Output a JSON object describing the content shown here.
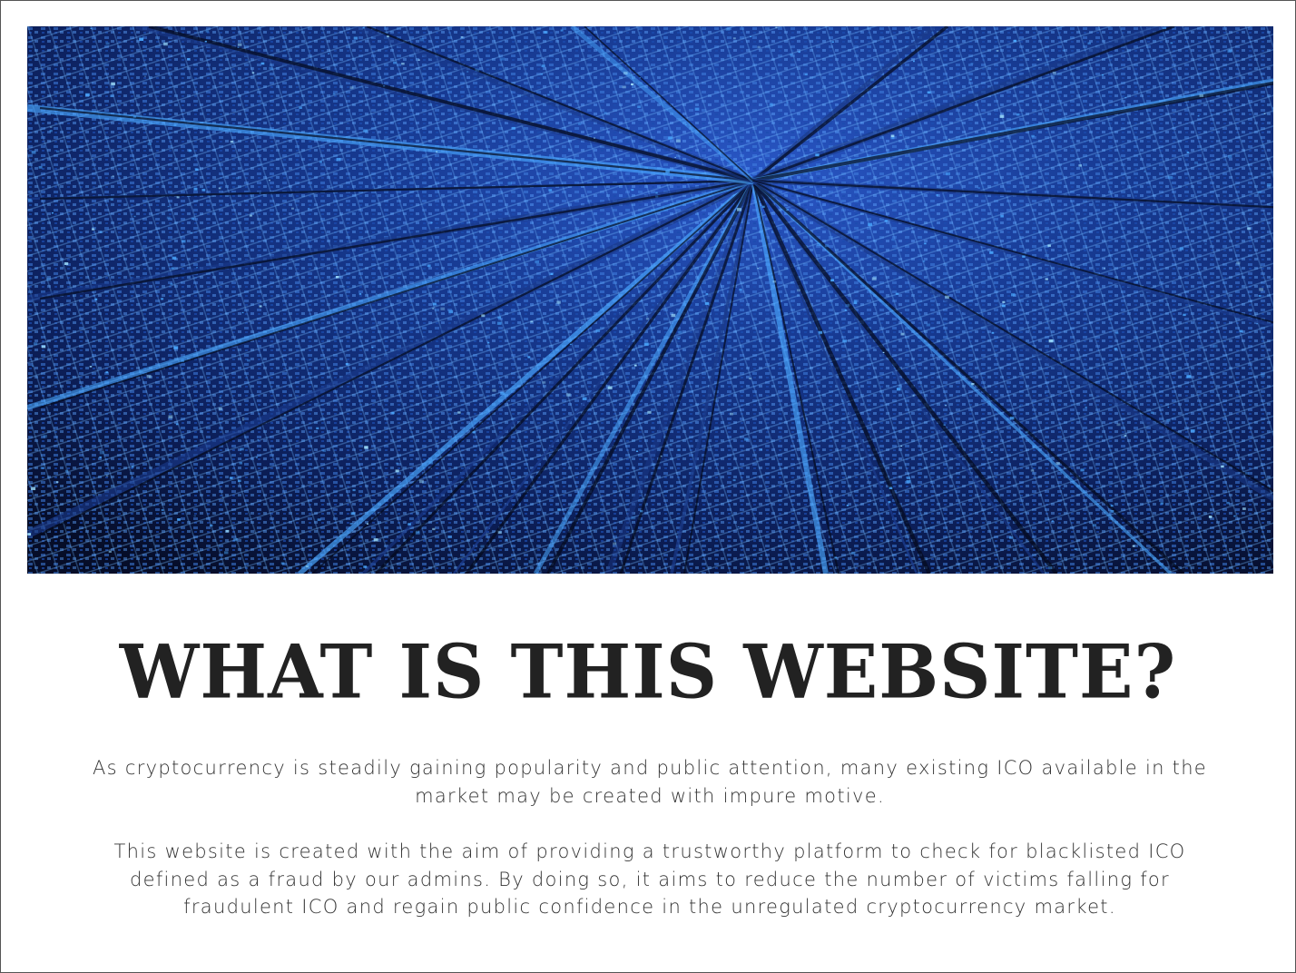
{
  "hero": {
    "image": "digital-circuit-tunnel-image",
    "colors": {
      "base": "#0a1430",
      "mid": "#1a3a8a",
      "glow": "#4aa8ff",
      "highlight": "#9fe0ff"
    }
  },
  "section": {
    "heading": "WHAT IS THIS WEBSITE?",
    "paragraph_1": "As cryptocurrency is steadily gaining popularity and public attention, many existing ICO available in the market may be created with impure motive.",
    "paragraph_2": "This website is created with the aim of providing a trustworthy platform to check for blacklisted ICO defined as a fraud by our admins. By doing so, it aims to reduce the number of victims falling for fraudulent ICO and regain public confidence in the unregulated cryptocurrency market."
  }
}
